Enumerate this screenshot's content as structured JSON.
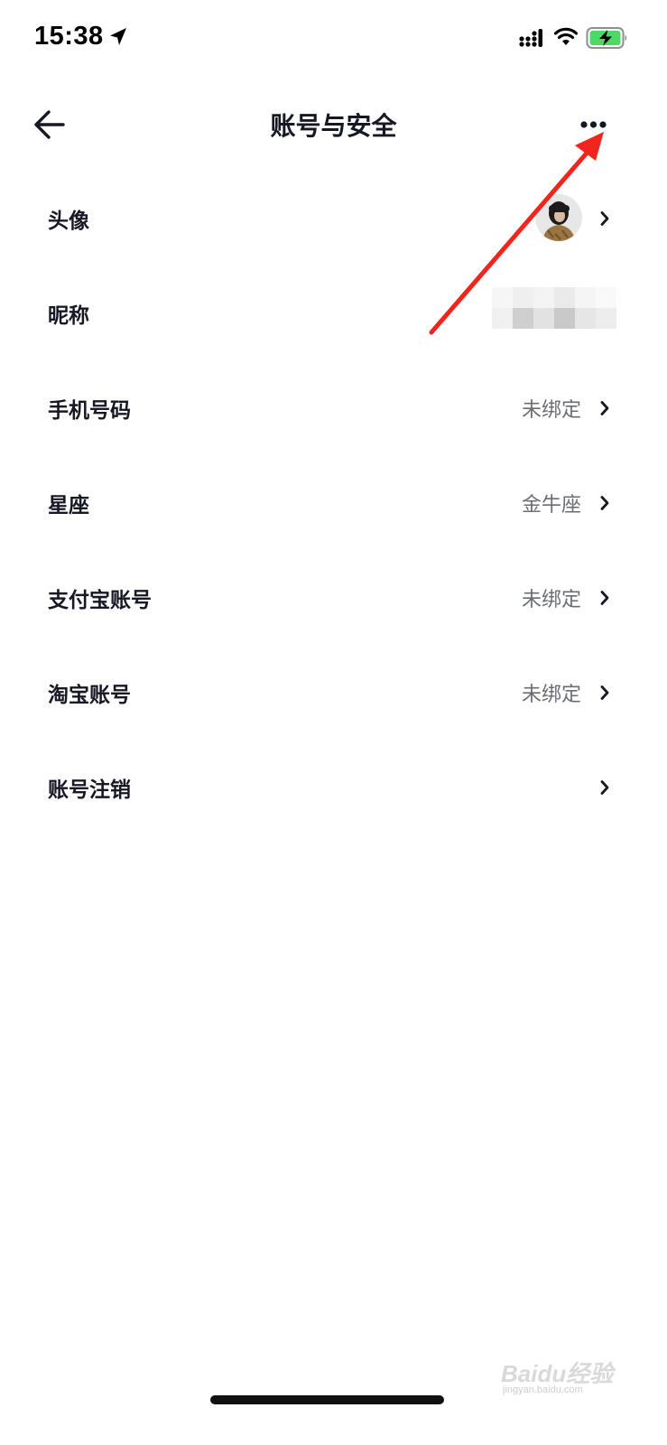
{
  "status_bar": {
    "time": "15:38",
    "icons": [
      "location-arrow-icon",
      "signal-icon",
      "wifi-icon",
      "battery-charging-icon"
    ],
    "battery_color": "#4cd964"
  },
  "header": {
    "title": "账号与安全",
    "back_icon": "arrow-left-icon",
    "more_icon": "more-dots-icon"
  },
  "settings": {
    "items": [
      {
        "label": "头像",
        "value": "",
        "has_avatar": true
      },
      {
        "label": "昵称",
        "value": "",
        "blurred": true
      },
      {
        "label": "手机号码",
        "value": "未绑定"
      },
      {
        "label": "星座",
        "value": "金牛座"
      },
      {
        "label": "支付宝账号",
        "value": "未绑定"
      },
      {
        "label": "淘宝账号",
        "value": "未绑定"
      },
      {
        "label": "账号注销",
        "value": ""
      }
    ]
  },
  "annotation": {
    "arrow_color": "#f0261e"
  },
  "watermark": {
    "text": "Baidu经验",
    "subtext": "jingyan.baidu.com"
  }
}
